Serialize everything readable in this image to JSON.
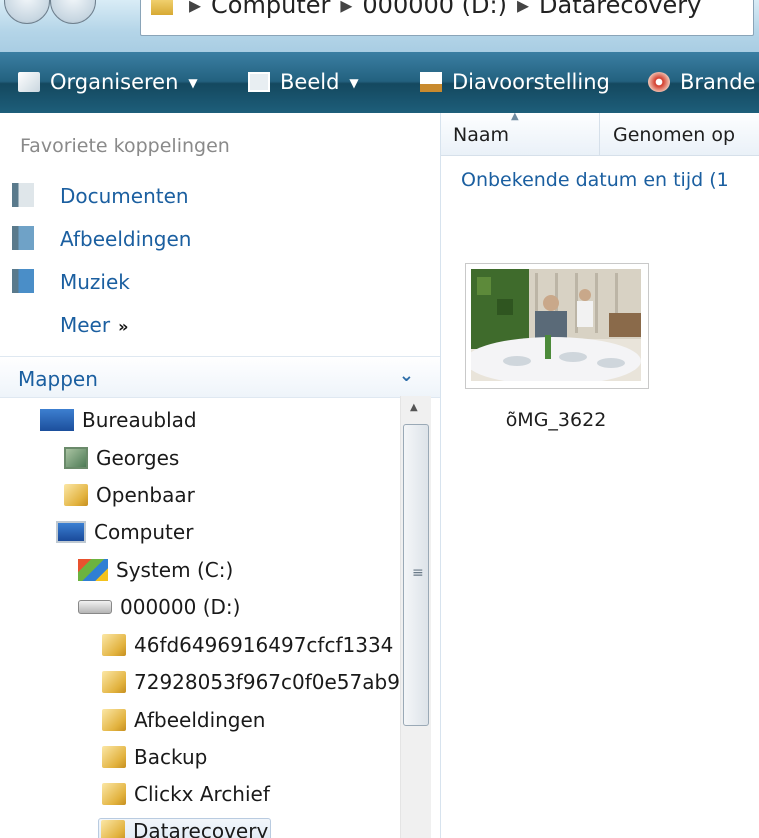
{
  "address": {
    "crumbs": [
      "Computer",
      "000000 (D:)",
      "Datarecovery"
    ]
  },
  "toolbar": {
    "organise_label": "Organiseren",
    "view_label": "Beeld",
    "slideshow_label": "Diavoorstelling",
    "burn_label": "Brande"
  },
  "left": {
    "favorites_header": "Favoriete koppelingen",
    "favorites": [
      {
        "label": "Documenten",
        "icon": "documents-icon"
      },
      {
        "label": "Afbeeldingen",
        "icon": "pictures-icon"
      },
      {
        "label": "Muziek",
        "icon": "music-icon"
      }
    ],
    "more_label": "Meer",
    "more_arrow": "»",
    "folders_header": "Mappen",
    "tree": [
      {
        "label": "Bureaublad",
        "icon": "desktop-icon"
      },
      {
        "label": "Georges",
        "icon": "user-folder-icon"
      },
      {
        "label": "Openbaar",
        "icon": "folder-icon"
      },
      {
        "label": "Computer",
        "icon": "computer-icon"
      },
      {
        "label": "System (C:)",
        "icon": "system-drive-icon"
      },
      {
        "label": "000000 (D:)",
        "icon": "drive-icon"
      },
      {
        "label": "46fd6496916497cfcf1334",
        "icon": "folder-icon"
      },
      {
        "label": "72928053f967c0f0e57ab9",
        "icon": "folder-icon"
      },
      {
        "label": "Afbeeldingen",
        "icon": "folder-icon"
      },
      {
        "label": "Backup",
        "icon": "folder-icon"
      },
      {
        "label": "Clickx Archief",
        "icon": "folder-icon"
      },
      {
        "label": "Datarecovery",
        "icon": "folder-icon"
      }
    ]
  },
  "right": {
    "columns": [
      "Naam",
      "Genomen op"
    ],
    "group_label": "Onbekende datum en tijd (1",
    "files": [
      {
        "name": "õMG_3622"
      }
    ]
  },
  "colors": {
    "toolbar": "#1d5e7a",
    "link": "#1b5fa0"
  }
}
